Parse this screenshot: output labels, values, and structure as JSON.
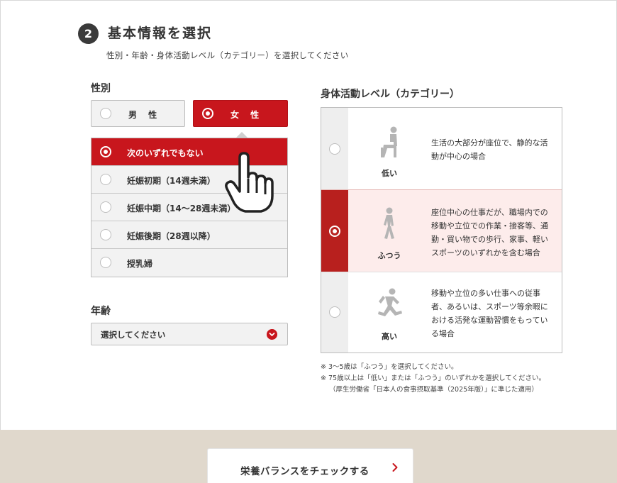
{
  "header": {
    "step_number": "2",
    "title": "基本情報を選択",
    "subtitle": "性別・年齢・身体活動レベル（カテゴリー）を選択してください"
  },
  "gender": {
    "label": "性別",
    "options": [
      {
        "label": "男 性",
        "selected": false
      },
      {
        "label": "女 性",
        "selected": true
      }
    ]
  },
  "pregnancy": {
    "options": [
      {
        "label": "次のいずれでもない",
        "selected": true
      },
      {
        "label": "妊娠初期（14週未満）",
        "selected": false
      },
      {
        "label": "妊娠中期（14〜28週未満）",
        "selected": false
      },
      {
        "label": "妊娠後期（28週以降）",
        "selected": false
      },
      {
        "label": "授乳婦",
        "selected": false
      }
    ]
  },
  "age": {
    "label": "年齢",
    "select_value": "選択してください"
  },
  "activity": {
    "label": "身体活動レベル（カテゴリー）",
    "options": [
      {
        "level": "低い",
        "icon": "sitting-person-icon",
        "description": "生活の大部分が座位で、静的な活動が中心の場合",
        "selected": false
      },
      {
        "level": "ふつう",
        "icon": "walking-person-icon",
        "description": "座位中心の仕事だが、職場内での移動や立位での作業・接客等、通勤・買い物での歩行、家事、軽いスポーツのいずれかを含む場合",
        "selected": true
      },
      {
        "level": "高い",
        "icon": "running-person-icon",
        "description": "移動や立位の多い仕事への従事者、あるいは、スポーツ等余暇における活発な運動習慣をもっている場合",
        "selected": false
      }
    ]
  },
  "notes": {
    "line1": "※ 3〜5歳は「ふつう」を選択してください。",
    "line2": "※ 75歳以上は「低い」または「ふつう」のいずれかを選択してください。",
    "line3": "（厚生労働省「日本人の食事摂取基準（2025年版）」に準じた適用）"
  },
  "cta": {
    "label": "栄養バランスをチェックする"
  },
  "colors": {
    "accent": "#c8161d",
    "selected_row_bg": "#fdeceb",
    "footer_bg": "#e0d8cc"
  }
}
